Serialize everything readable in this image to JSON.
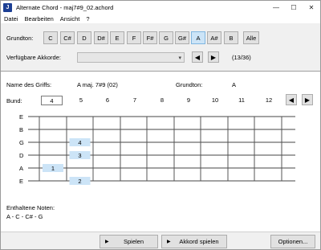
{
  "window": {
    "title": "Alternate Chord - maj7#9_02.achord",
    "app_icon_letter": "J",
    "minimize_glyph": "—",
    "maximize_glyph": "☐",
    "close_glyph": "✕"
  },
  "menu": [
    "Datei",
    "Bearbeiten",
    "Ansicht",
    "?"
  ],
  "top": {
    "grundton_label": "Grundton:",
    "keys": [
      "C",
      "C#",
      "D",
      "D#",
      "E",
      "F",
      "F#",
      "G",
      "G#",
      "A",
      "A#",
      "B",
      "Alle"
    ],
    "selected_key": "A",
    "chords_label": "Verfügbare Akkorde:",
    "combo_value": "",
    "prev_glyph": "◀",
    "next_glyph": "▶",
    "counter": "(13/36)"
  },
  "info": {
    "name_label": "Name des Griffs:",
    "name_value": "A maj. 7#9 (02)",
    "root_label": "Grundton:",
    "root_value": "A",
    "bund_label": "Bund:",
    "bund_value": "4",
    "frets": [
      "5",
      "6",
      "7",
      "8",
      "9",
      "10",
      "11",
      "12"
    ],
    "prev_glyph": "◀",
    "next_glyph": "▶"
  },
  "fretboard": {
    "strings": [
      "E",
      "B",
      "G",
      "D",
      "A",
      "E"
    ],
    "fingers": [
      {
        "string": 2,
        "fret": 2,
        "label": "4"
      },
      {
        "string": 3,
        "fret": 2,
        "label": "3"
      },
      {
        "string": 4,
        "fret": 1,
        "label": "1"
      },
      {
        "string": 5,
        "fret": 2,
        "label": "2"
      }
    ]
  },
  "notes": {
    "label": "Enthaltene Noten:",
    "value": "A - C - C# - G"
  },
  "bottom": {
    "spielen": "Spielen",
    "akkord_spielen": "Akkord spielen",
    "optionen": "Optionen..."
  },
  "colors": {
    "selected_key_bg": "#cce4f7",
    "finger_marker_bg": "#cce4f7",
    "app_icon_bg": "#1c3f94"
  }
}
